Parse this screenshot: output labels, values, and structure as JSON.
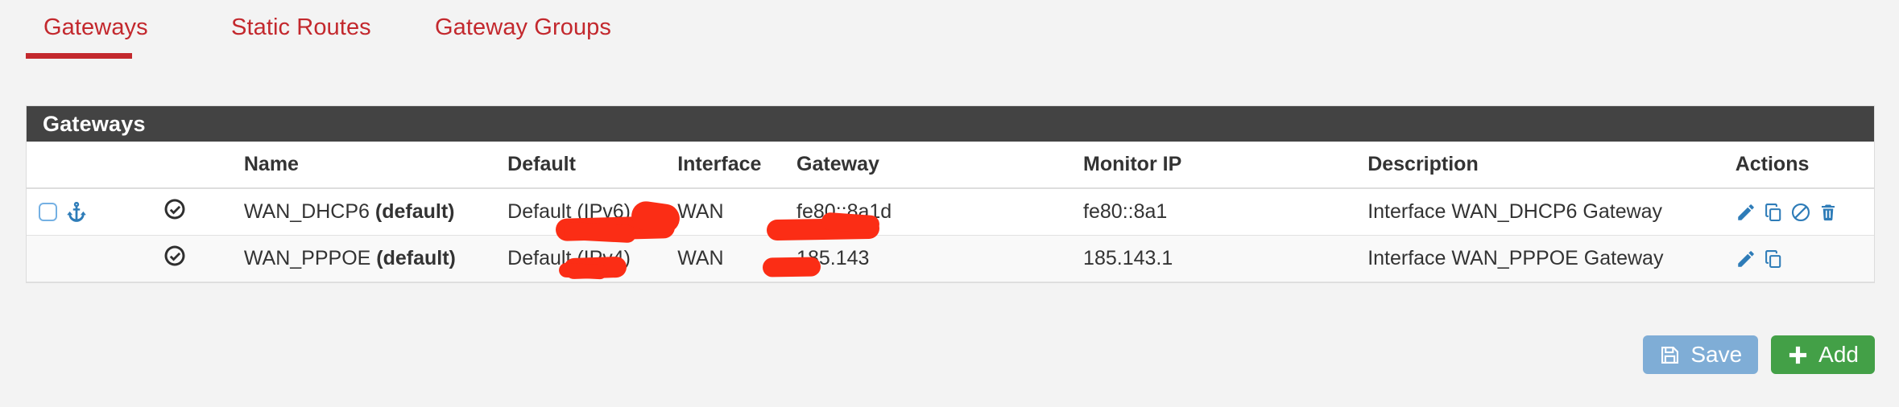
{
  "tabs": [
    {
      "label": "Gateways",
      "active": true
    },
    {
      "label": "Static Routes",
      "active": false
    },
    {
      "label": "Gateway Groups",
      "active": false
    }
  ],
  "panel": {
    "title": "Gateways"
  },
  "table": {
    "columns": [
      "",
      "",
      "Name",
      "Default",
      "Interface",
      "Gateway",
      "Monitor IP",
      "Description",
      "Actions"
    ],
    "headers": {
      "name": "Name",
      "default": "Default",
      "interface": "Interface",
      "gateway": "Gateway",
      "monitor_ip": "Monitor IP",
      "description": "Description",
      "actions": "Actions"
    },
    "rows": [
      {
        "has_checkbox": true,
        "checkbox_checked": false,
        "anchor_icon": "anchor-icon",
        "state_icon": "check-circle-icon",
        "name": "WAN_DHCP6",
        "name_suffix": "(default)",
        "default": "Default (IPv6)",
        "interface": "WAN",
        "gateway": "fe80::8a1d",
        "gateway_redacted": true,
        "monitor_ip": "fe80::8a1",
        "monitor_ip_redacted": true,
        "description": "Interface WAN_DHCP6 Gateway",
        "actions": [
          "edit-icon",
          "copy-icon",
          "disable-icon",
          "delete-icon"
        ]
      },
      {
        "has_checkbox": false,
        "checkbox_checked": false,
        "anchor_icon": "",
        "state_icon": "check-circle-icon",
        "name": "WAN_PPPOE",
        "name_suffix": "(default)",
        "default": "Default (IPv4)",
        "interface": "WAN",
        "gateway": "185.143",
        "gateway_redacted": true,
        "monitor_ip": "185.143.1",
        "monitor_ip_redacted": true,
        "description": "Interface WAN_PPPOE Gateway",
        "actions": [
          "edit-icon",
          "copy-icon"
        ]
      }
    ]
  },
  "buttons": {
    "save": {
      "label": "Save",
      "icon": "floppy-save-icon",
      "color": "#7fadd6"
    },
    "add": {
      "label": "Add",
      "icon": "plus-icon",
      "color": "#43a047"
    }
  },
  "colors": {
    "tab_active": "#c3282d",
    "panel_header_bg": "#434343",
    "icon_blue": "#2e7cb8",
    "redaction_red": "#fb2d15",
    "page_bg": "#f3f3f3"
  }
}
